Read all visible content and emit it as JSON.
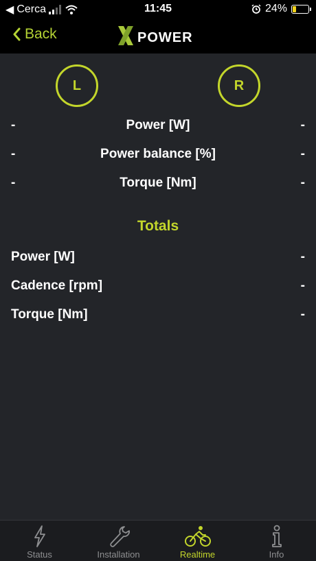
{
  "status_bar": {
    "carrier": "Cerca",
    "time": "11:45",
    "battery_percent": "24%",
    "battery_level": 0.24
  },
  "nav": {
    "back_label": "Back",
    "logo_text": "XPOWER"
  },
  "sides": {
    "left_label": "L",
    "right_label": "R"
  },
  "side_metrics": [
    {
      "label": "Power [W]",
      "left": "-",
      "right": "-"
    },
    {
      "label": "Power balance [%]",
      "left": "-",
      "right": "-"
    },
    {
      "label": "Torque [Nm]",
      "left": "-",
      "right": "-"
    }
  ],
  "totals": {
    "title": "Totals",
    "rows": [
      {
        "label": "Power [W]",
        "value": "-"
      },
      {
        "label": "Cadence [rpm]",
        "value": "-"
      },
      {
        "label": "Torque [Nm]",
        "value": "-"
      }
    ]
  },
  "tabs": [
    {
      "label": "Status",
      "icon": "lightning-icon"
    },
    {
      "label": "Installation",
      "icon": "wrench-icon"
    },
    {
      "label": "Realtime",
      "icon": "cyclist-icon",
      "active": true
    },
    {
      "label": "Info",
      "icon": "info-icon"
    }
  ],
  "colors": {
    "accent": "#c3d62b",
    "background": "#232529",
    "bars": "#000000"
  }
}
